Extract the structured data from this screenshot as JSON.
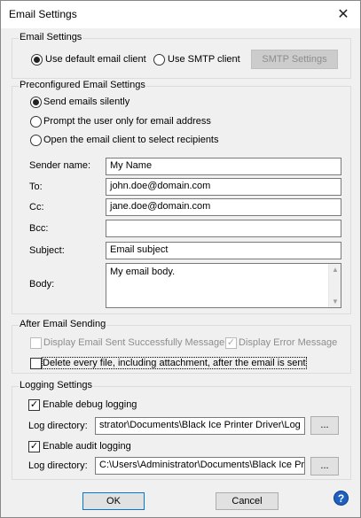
{
  "window": {
    "title": "Email Settings",
    "close_glyph": "✕"
  },
  "email_settings": {
    "group_label": "Email Settings",
    "use_default_label": "Use default email client",
    "use_smtp_label": "Use SMTP client",
    "smtp_settings_button": "SMTP Settings",
    "selected": "use_default"
  },
  "preconfigured": {
    "group_label": "Preconfigured Email Settings",
    "options": [
      "Send emails silently",
      "Prompt the user only for email address",
      "Open the email client to select recipients"
    ],
    "selected_index": 0,
    "fields": {
      "sender_label": "Sender name:",
      "sender_value": "My Name",
      "to_label": "To:",
      "to_value": "john.doe@domain.com",
      "cc_label": "Cc:",
      "cc_value": "jane.doe@domain.com",
      "bcc_label": "Bcc:",
      "bcc_value": "",
      "subject_label": "Subject:",
      "subject_value": "Email subject",
      "body_label": "Body:",
      "body_value": "My email body."
    }
  },
  "after_sending": {
    "group_label": "After Email Sending",
    "display_sent_label": "Display Email Sent Successfully Message",
    "display_sent_checked": false,
    "display_error_label": "Display Error Message",
    "display_error_checked": true,
    "delete_files_label": "Delete every file, including attachment, after the email is sent",
    "delete_files_checked": false
  },
  "logging": {
    "group_label": "Logging Settings",
    "debug_label": "Enable debug logging",
    "debug_checked": true,
    "debug_dir_label": "Log directory:",
    "debug_dir_value": "strator\\Documents\\Black Ice Printer Driver\\Log",
    "audit_label": "Enable audit logging",
    "audit_checked": true,
    "audit_dir_label": "Log directory:",
    "audit_dir_value": "C:\\Users\\Administrator\\Documents\\Black Ice Pri",
    "browse_label": "..."
  },
  "footer": {
    "ok_label": "OK",
    "cancel_label": "Cancel",
    "help_glyph": "?"
  },
  "icons": {
    "check": "✓",
    "scroll_up": "▲",
    "scroll_down": "▼"
  }
}
